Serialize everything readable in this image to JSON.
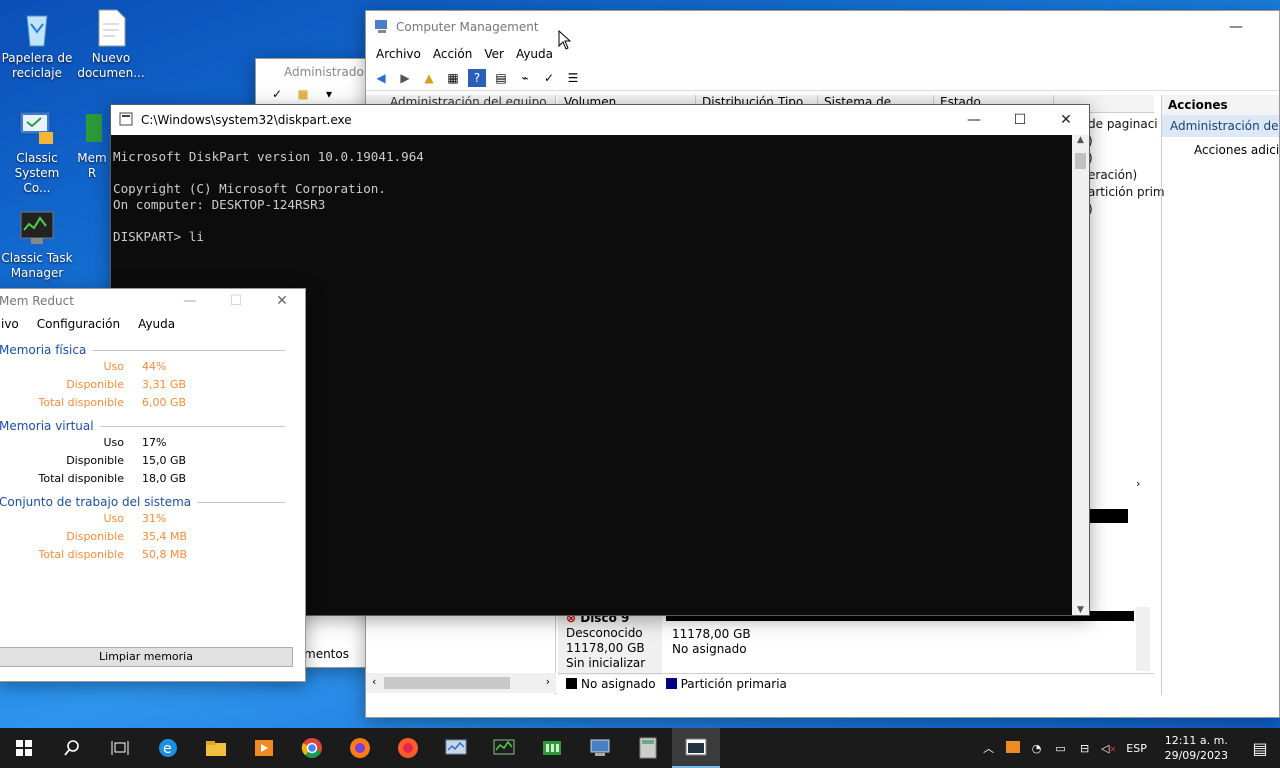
{
  "desktop": {
    "icons": [
      {
        "label": "Papelera de reciclaje",
        "icon": "recycle-bin-icon"
      },
      {
        "label": "Nuevo documen...",
        "icon": "document-icon"
      },
      {
        "label": "Classic System Co...",
        "icon": "control-panel-icon"
      },
      {
        "label": "Mem R",
        "icon": "mem-reduct-icon"
      },
      {
        "label": "Classic Task Manager",
        "icon": "task-manager-icon"
      }
    ]
  },
  "computer_management": {
    "title": "Computer Management",
    "menu": [
      "Archivo",
      "Acción",
      "Ver",
      "Ayuda"
    ],
    "tree_header": "Administración del equipo (loc",
    "columns": [
      "Volumen",
      "Distribución",
      "Tipo",
      "Sistema de archivos",
      "Estado"
    ],
    "partial_rows": [
      "de paginaci",
      ")",
      ")",
      "eración)",
      "artición prim",
      ")"
    ],
    "actions_header": "Acciones",
    "actions_selected": "Administración de dis",
    "actions_item": "Acciones adicior",
    "disk": {
      "name": "Disco 9",
      "status": "Desconocido",
      "size": "11178,00 GB",
      "init": "Sin inicializar",
      "part_size": "11178,00 GB",
      "part_state": "No asignado"
    },
    "legend": [
      {
        "label": "No asignado",
        "color": "#000000"
      },
      {
        "label": "Partición primaria",
        "color": "#000080"
      }
    ]
  },
  "admin_window": {
    "title": "Administrador",
    "partial": "mentos"
  },
  "diskpart": {
    "title": "C:\\Windows\\system32\\diskpart.exe",
    "lines": {
      "l1": "Microsoft DiskPart version 10.0.19041.964",
      "l2": "Copyright (C) Microsoft Corporation.",
      "l3": "On computer: DESKTOP-124RSR3",
      "l4": "DISKPART> li"
    }
  },
  "mem_reduct": {
    "title": "Mem Reduct",
    "menu": [
      "ivo",
      "Configuración",
      "Ayuda"
    ],
    "sections": [
      {
        "title": "Memoria física",
        "warn": true,
        "rows": [
          [
            "Uso",
            "44%"
          ],
          [
            "Disponible",
            "3,31 GB"
          ],
          [
            "Total disponible",
            "6,00 GB"
          ]
        ]
      },
      {
        "title": "Memoria virtual",
        "warn": false,
        "rows": [
          [
            "Uso",
            "17%"
          ],
          [
            "Disponible",
            "15,0 GB"
          ],
          [
            "Total disponible",
            "18,0 GB"
          ]
        ]
      },
      {
        "title": "Conjunto de trabajo del sistema",
        "warn": true,
        "rows": [
          [
            "Uso",
            "31%"
          ],
          [
            "Disponible",
            "35,4 MB"
          ],
          [
            "Total disponible",
            "50,8 MB"
          ]
        ]
      }
    ],
    "clean_button": "Limpiar memoria"
  },
  "taskbar": {
    "apps": [
      "start-icon",
      "search-icon",
      "task-view-icon",
      "edge-icon",
      "file-explorer-icon",
      "media-player-icon",
      "chrome-icon",
      "firefox-icon",
      "firefox-dev-icon",
      "system-monitor-icon",
      "task-manager-icon",
      "mem-reduct-icon",
      "computer-management-icon",
      "calculator-icon",
      "diskpart-icon"
    ],
    "lang": "ESP",
    "time": "12:11 a. m.",
    "date": "29/09/2023"
  }
}
